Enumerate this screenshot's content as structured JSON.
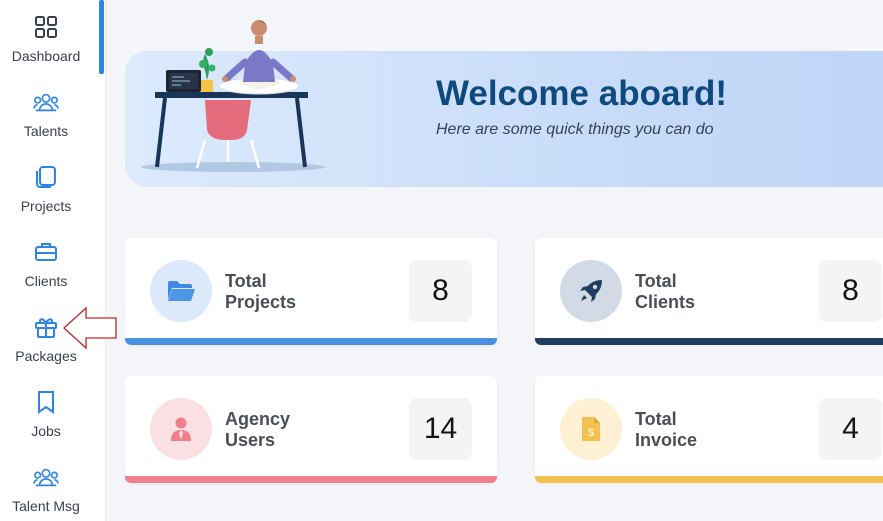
{
  "sidebar": {
    "items": [
      {
        "label": "Dashboard",
        "icon": "grid-icon"
      },
      {
        "label": "Talents",
        "icon": "users-icon"
      },
      {
        "label": "Projects",
        "icon": "copy-icon"
      },
      {
        "label": "Clients",
        "icon": "briefcase-icon"
      },
      {
        "label": "Packages",
        "icon": "gift-icon"
      },
      {
        "label": "Jobs",
        "icon": "bookmark-icon"
      },
      {
        "label": "Talent Msg",
        "icon": "users-icon"
      }
    ],
    "active": "Dashboard"
  },
  "welcome": {
    "title": "Welcome aboard!",
    "subtitle": "Here are some quick things you can do"
  },
  "cards": [
    {
      "line1": "Total",
      "line2": "Projects",
      "value": "8",
      "icon": "folder-icon",
      "color": "#4a90e2"
    },
    {
      "line1": "Total",
      "line2": "Clients",
      "value": "8",
      "icon": "rocket-icon",
      "color": "#1f3d5c"
    },
    {
      "line1": "Agency",
      "line2": "Users",
      "value": "14",
      "icon": "user-tie-icon",
      "color": "#ee7f8b"
    },
    {
      "line1": "Total",
      "line2": "Invoice",
      "value": "4",
      "icon": "invoice-icon",
      "color": "#f2c14e"
    }
  ],
  "colors": {
    "accent": "#2d86e6",
    "welcome_title": "#0f4a7e",
    "arrow": "#c0272d"
  }
}
